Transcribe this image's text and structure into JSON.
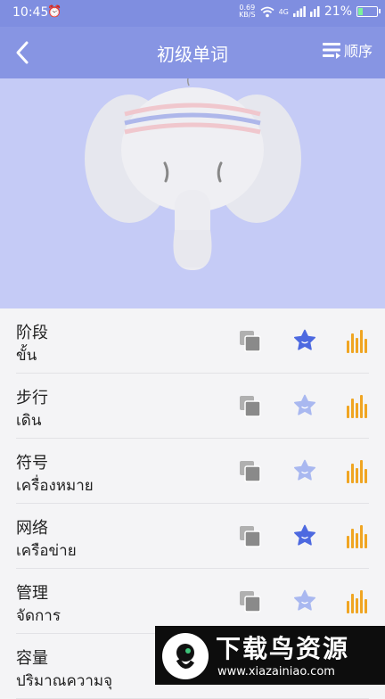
{
  "status_bar": {
    "time": "10:45",
    "net_speed_value": "0.69",
    "net_speed_unit": "KB/S",
    "net_type": "4G",
    "battery": "21%",
    "battery_level": 0.21,
    "alarm_icon": "alarm-icon",
    "wifi_icon": "wifi-icon",
    "signal_icon": "signal-icon"
  },
  "app_bar": {
    "title": "初级单词",
    "order_label": "顺序",
    "back_icon": "back-arrow-icon",
    "order_icon": "list-order-icon"
  },
  "colors": {
    "header": "#8795e3",
    "hero_bg": "#c5cbf6",
    "star_filled": "#4d69e0",
    "star_outline": "#a9b8f0",
    "audio": "#f0a522",
    "copy": "#8a8a8a"
  },
  "words": [
    {
      "zh": "阶段",
      "th": "ขั้น",
      "starred": true
    },
    {
      "zh": "步行",
      "th": "เดิน",
      "starred": false
    },
    {
      "zh": "符号",
      "th": "เครื่องหมาย",
      "starred": false
    },
    {
      "zh": "网络",
      "th": "เครือข่าย",
      "starred": true
    },
    {
      "zh": "管理",
      "th": "จัดการ",
      "starred": false
    },
    {
      "zh": "容量",
      "th": "ปริมาณความจุ",
      "starred": false
    }
  ],
  "watermark": {
    "title": "下载鸟资源",
    "url": "www.xiazainiao.com"
  }
}
